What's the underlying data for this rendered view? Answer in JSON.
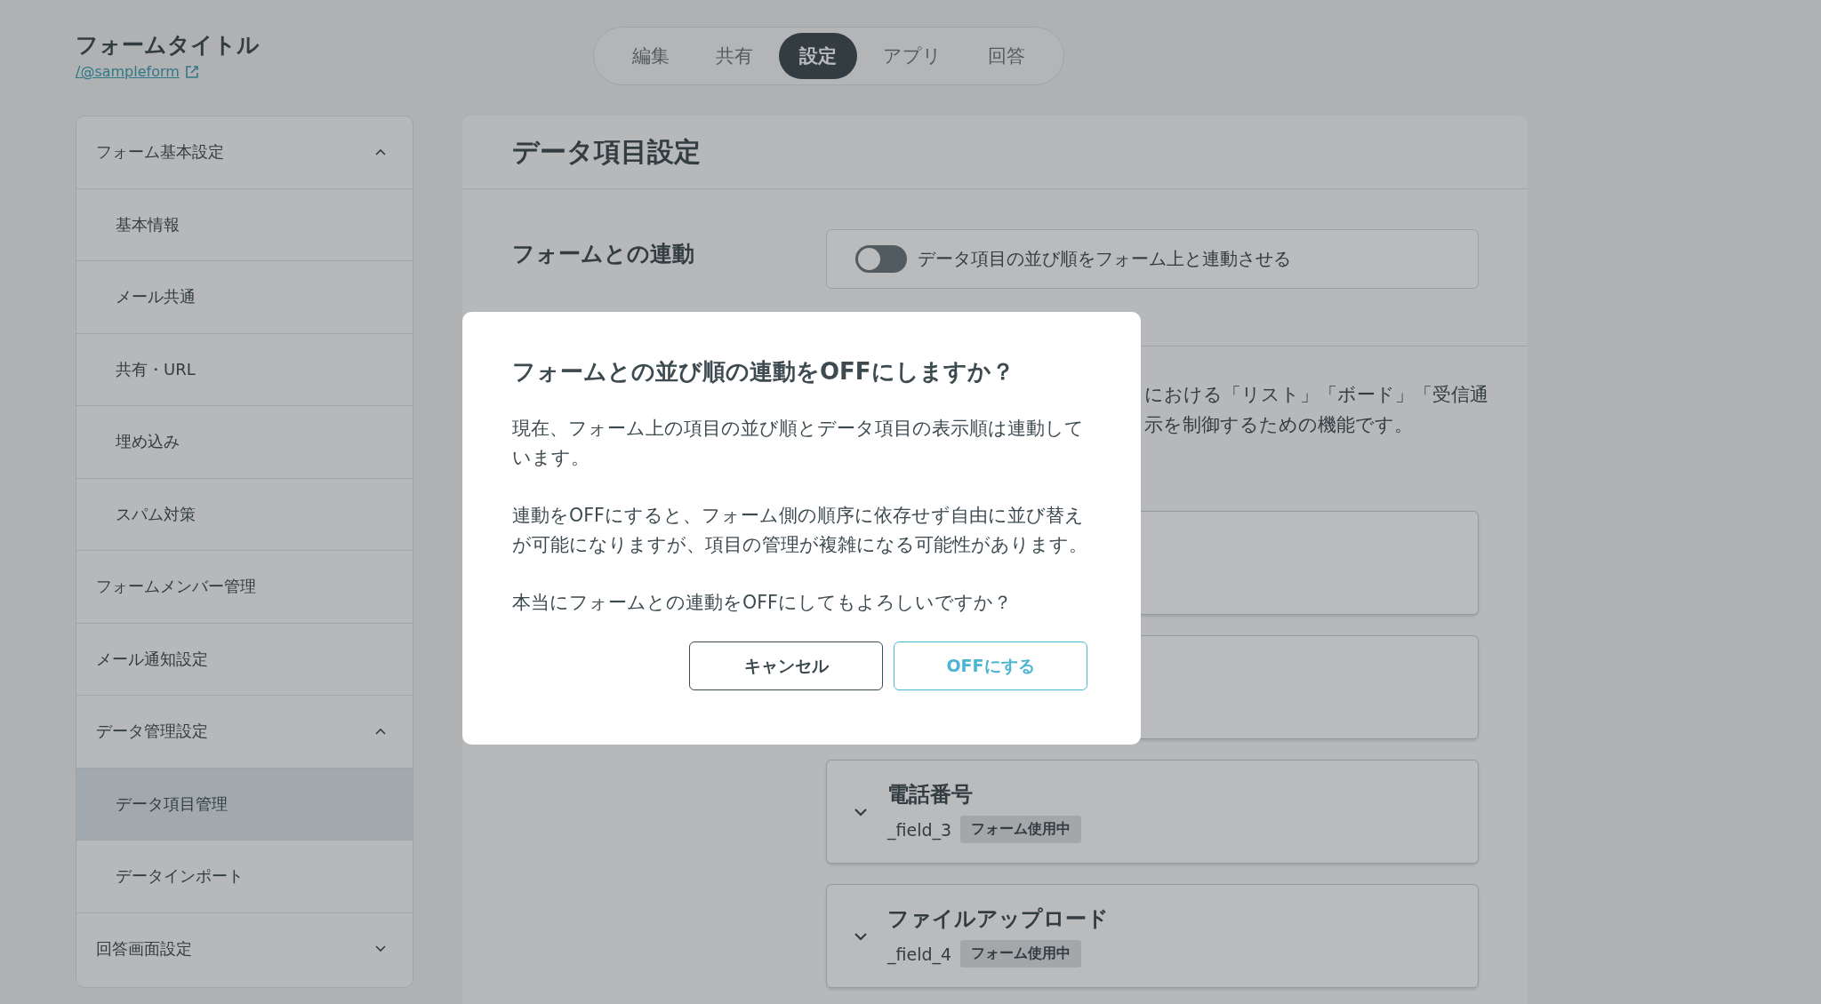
{
  "form": {
    "title": "フォームタイトル",
    "link": "/@sampleform"
  },
  "tabs": [
    {
      "label": "編集",
      "selected": false
    },
    {
      "label": "共有",
      "selected": false
    },
    {
      "label": "設定",
      "selected": true
    },
    {
      "label": "アプリ",
      "selected": false
    },
    {
      "label": "回答",
      "selected": false
    }
  ],
  "sidebar": {
    "items": [
      {
        "label": "フォーム基本設定",
        "expanded": true,
        "selected": false,
        "children": [
          {
            "label": "基本情報",
            "selected": false
          },
          {
            "label": "メール共通",
            "selected": false
          },
          {
            "label": "共有・URL",
            "selected": false
          },
          {
            "label": "埋め込み",
            "selected": false
          },
          {
            "label": "スパム対策",
            "selected": false
          }
        ]
      },
      {
        "label": "フォームメンバー管理",
        "selected": false
      },
      {
        "label": "メール通知設定",
        "selected": false
      },
      {
        "label": "データ管理設定",
        "expanded": true,
        "selected": false,
        "children": [
          {
            "label": "データ項目管理",
            "selected": true
          },
          {
            "label": "データインポート",
            "selected": false
          }
        ]
      },
      {
        "label": "回答画面設定",
        "expanded": false,
        "selected": false
      }
    ]
  },
  "main": {
    "title": "データ項目設定",
    "section_title": "フォームとの連動",
    "toggle": {
      "label": "データ項目の並び順をフォーム上と連動させる",
      "on": false
    },
    "description_lines": [
      "における「リスト」「ボード」「受信通",
      "示を制御するための機能です。"
    ],
    "field_cards": [
      {
        "kind": "covered"
      },
      {
        "kind": "covered"
      },
      {
        "kind": "field",
        "name": "電話番号",
        "code": "_field_3",
        "badge": "フォーム使用中"
      },
      {
        "kind": "field",
        "name": "ファイルアップロード",
        "code": "_field_4",
        "badge": "フォーム使用中"
      }
    ]
  },
  "dialog": {
    "title": "フォームとの並び順の連動をOFFにしますか？",
    "paragraphs": [
      "現在、フォーム上の項目の並び順とデータ項目の表示順は連動しています。",
      "連動をOFFにすると、フォーム側の順序に依存せず自由に並び替えが可能になりますが、項目の管理が複雑になる可能性があります。",
      "本当にフォームとの連動をOFFにしてもよろしいですか？"
    ],
    "cancel": "キャンセル",
    "confirm": "OFFにする"
  }
}
